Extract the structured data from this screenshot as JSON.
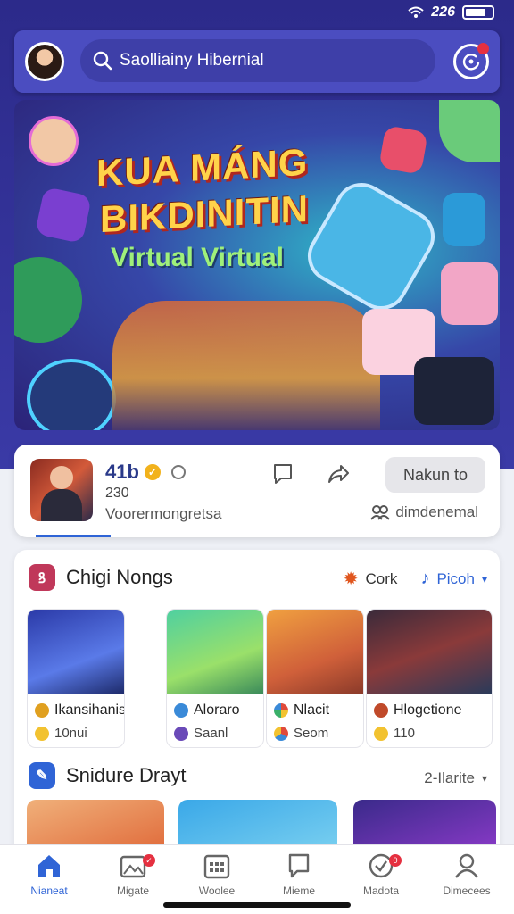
{
  "status_bar": {
    "time": "226"
  },
  "header": {
    "search_placeholder": "Saolliainy Hibernial"
  },
  "banner": {
    "title_line1": "KUA MÁNG",
    "title_line2": "BIKDINITIN",
    "subtitle": "Virtual Virtual"
  },
  "info_card": {
    "count": "41b",
    "sub": "230",
    "description": "Voorermongretsa",
    "join_label": "Nakun to",
    "meta": "dimdenemal"
  },
  "section1": {
    "title": "Chigi Nongs",
    "right_label1": "Cork",
    "right_label2": "Picoh",
    "tiles": [
      {
        "title": "Ikansihanis",
        "sub": "10nui"
      },
      {
        "title": "Aloraro",
        "sub": "Saanl"
      },
      {
        "title": "Nlacit",
        "sub": "Seom"
      },
      {
        "title": "Hlogetione",
        "sub": "110"
      }
    ]
  },
  "section2": {
    "title": "Snidure Drayt",
    "right_label": "2-Ilarite"
  },
  "bottom_nav": [
    {
      "label": "Nianeat",
      "badge": ""
    },
    {
      "label": "Migate",
      "badge": ""
    },
    {
      "label": "Woolee",
      "badge": ""
    },
    {
      "label": "Mieme",
      "badge": ""
    },
    {
      "label": "Madota",
      "badge": "0"
    },
    {
      "label": "Dimecees",
      "badge": ""
    }
  ],
  "colors": {
    "accent": "#2f64d6",
    "header": "#4b4dc0",
    "badge": "#e53040"
  }
}
